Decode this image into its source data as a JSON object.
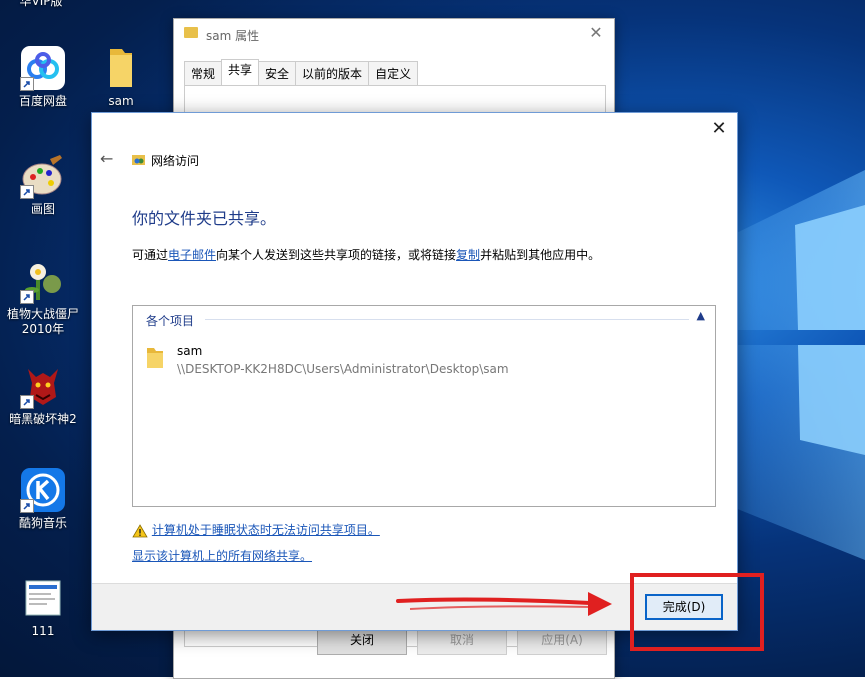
{
  "desktop": {
    "top_label": "华VIP版",
    "icons": [
      {
        "label": "百度网盘",
        "icon": "baidu-netdisk-icon"
      },
      {
        "label": "sam",
        "icon": "folder-icon"
      },
      {
        "label": "画图",
        "icon": "paint-icon"
      },
      {
        "label": "植物大战僵尸2010年",
        "icon": "plants-vs-zombies-icon"
      },
      {
        "label": "暗黑破坏神2",
        "icon": "diablo-icon"
      },
      {
        "label": "酷狗音乐",
        "icon": "kugou-icon"
      },
      {
        "label": "111",
        "icon": "file-icon"
      }
    ],
    "accent": "#0f58b8"
  },
  "properties_window": {
    "title": "sam 属性",
    "tabs": [
      "常规",
      "共享",
      "安全",
      "以前的版本",
      "自定义"
    ],
    "active_tab": "共享",
    "buttons": [
      "关闭",
      "取消",
      "应用(A)"
    ]
  },
  "dialog": {
    "nav_title": "网络访问",
    "heading": "你的文件夹已共享。",
    "desc": {
      "part1": "可通过",
      "link_email": "电子邮件",
      "part2": "向某个人发送到这些共享项的链接，或将链接",
      "link_copy": "复制",
      "part3": "并粘贴到其他应用中。"
    },
    "group_header": "各个项目",
    "item": {
      "name": "sam",
      "path": "\\\\DESKTOP-KK2H8DC\\Users\\Administrator\\Desktop\\sam"
    },
    "warning_link": "计算机处于睡眠状态时无法访问共享项目。",
    "show_all_link": "显示该计算机上的所有网络共享。",
    "done_button": "完成(D)",
    "link_color": "#1a56b8",
    "heading_color": "#1f3c8a"
  },
  "annotation": {
    "color": "#e02020"
  }
}
